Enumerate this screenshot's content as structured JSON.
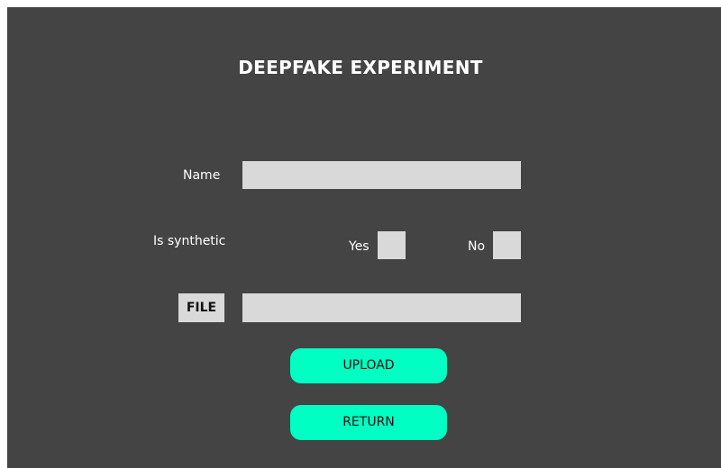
{
  "title": "DEEPFAKE EXPERIMENT",
  "form": {
    "name_label": "Name",
    "name_value": "",
    "synthetic_label": "Is synthetic",
    "yes_label": "Yes",
    "no_label": "No",
    "file_button_label": "FILE",
    "file_value": ""
  },
  "buttons": {
    "upload_label": "UPLOAD",
    "return_label": "RETURN"
  },
  "colors": {
    "background": "#444444",
    "field": "#d9d9d9",
    "accent": "#00ffc3"
  }
}
